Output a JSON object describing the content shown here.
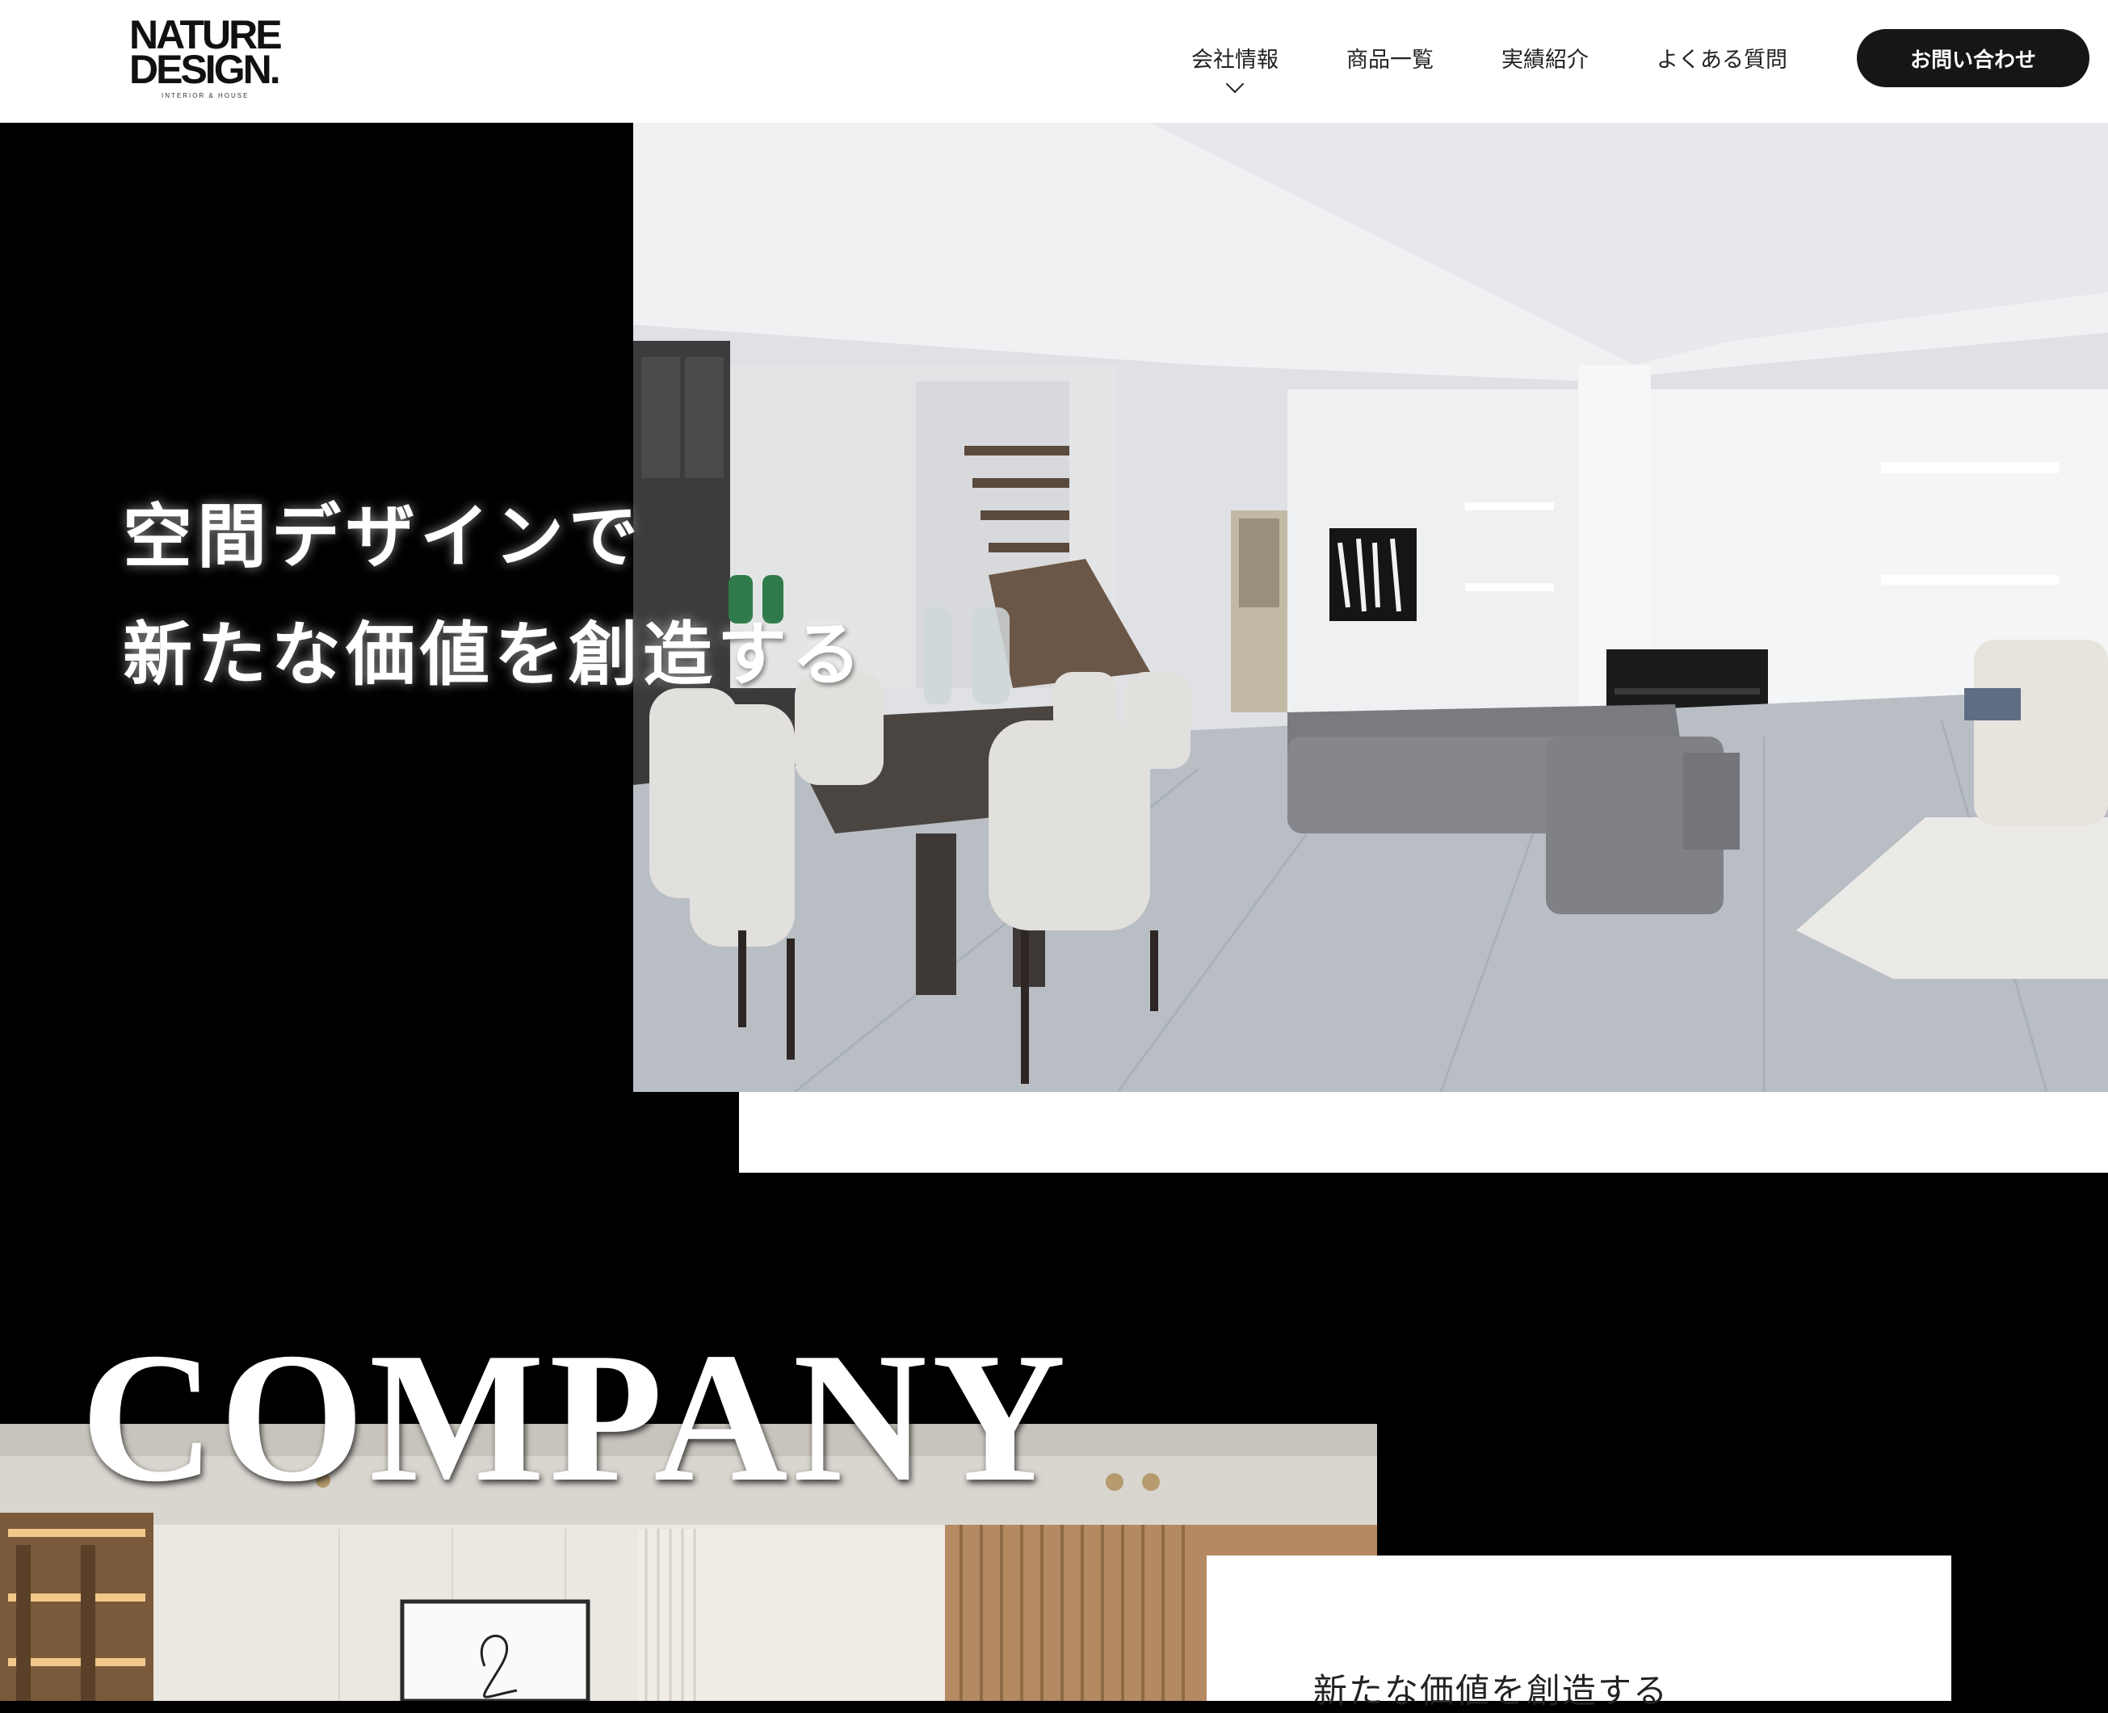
{
  "header": {
    "logo": {
      "line1": "NATURE",
      "line2": "DESIGN.",
      "tagline": "INTERIOR & HOUSE"
    },
    "nav": [
      {
        "label": "会社情報",
        "has_dropdown": true
      },
      {
        "label": "商品一覧",
        "has_dropdown": false
      },
      {
        "label": "実績紹介",
        "has_dropdown": false
      },
      {
        "label": "よくある質問",
        "has_dropdown": false
      }
    ],
    "contact_label": "お問い合わせ"
  },
  "hero": {
    "title_line1": "空間デザインで",
    "title_line2": "新たな価値を創造する"
  },
  "company": {
    "heading": "COMPANY",
    "card_title": "新たな価値を創造する"
  },
  "colors": {
    "background": "#000000",
    "header_bg": "#ffffff",
    "button_bg": "#161616",
    "text_dark": "#222222"
  }
}
